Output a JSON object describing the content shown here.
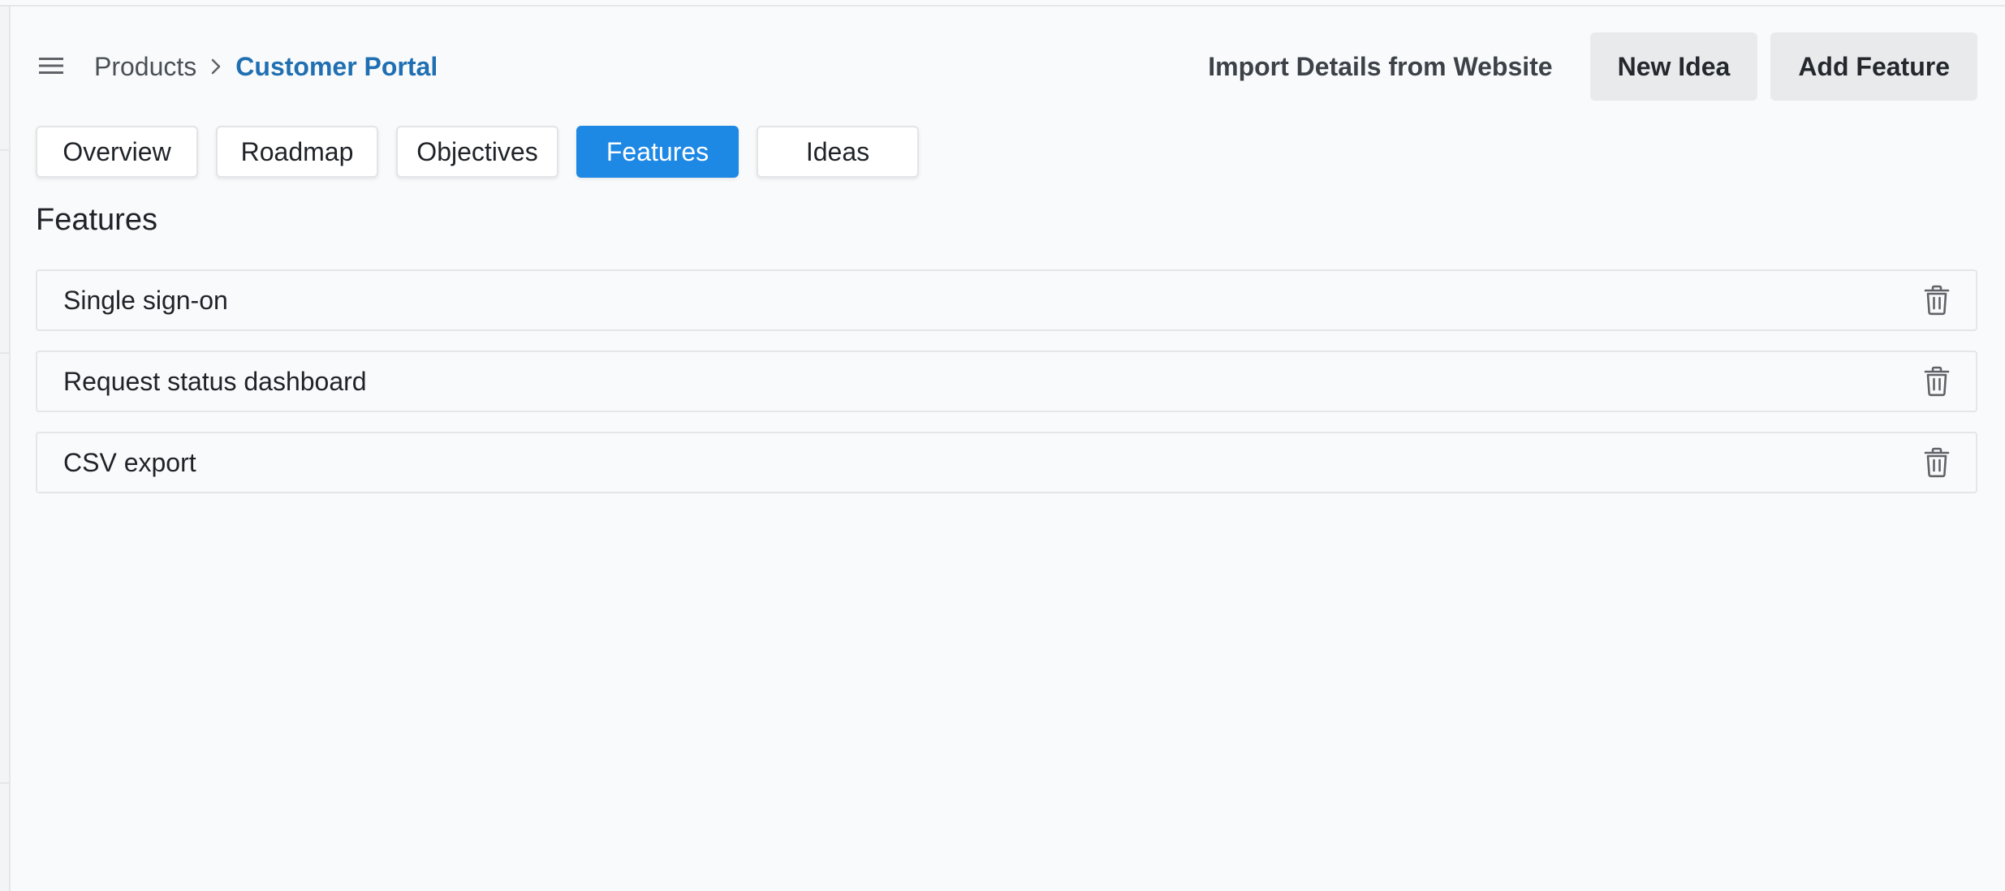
{
  "header": {
    "menu_icon": "hamburger-menu-icon",
    "breadcrumb": {
      "parent": "Products",
      "separator_icon": "chevron-right-icon",
      "current": "Customer Portal"
    },
    "actions": {
      "import_label": "Import Details from Website",
      "new_idea_label": "New Idea",
      "add_feature_label": "Add Feature"
    }
  },
  "tabs": [
    {
      "label": "Overview",
      "active": false
    },
    {
      "label": "Roadmap",
      "active": false
    },
    {
      "label": "Objectives",
      "active": false
    },
    {
      "label": "Features",
      "active": true
    },
    {
      "label": "Ideas",
      "active": false
    }
  ],
  "section": {
    "title": "Features"
  },
  "features": [
    {
      "name": "Single sign-on",
      "action_icon": "trash-icon"
    },
    {
      "name": "Request status dashboard",
      "action_icon": "trash-icon"
    },
    {
      "name": "CSV export",
      "action_icon": "trash-icon"
    }
  ],
  "colors": {
    "accent": "#1e88e5",
    "breadcrumb_link": "#1f6fb2",
    "background": "#f9fafb",
    "button_gray": "#e9eaec"
  }
}
